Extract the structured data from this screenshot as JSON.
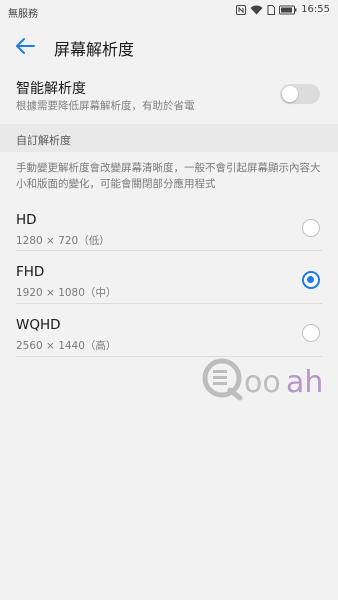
{
  "status_bar": {
    "carrier": "無服務",
    "time": "16:55",
    "icons": [
      "nfc-icon",
      "wifi-icon",
      "sim-icon",
      "battery-icon"
    ]
  },
  "header": {
    "title": "屏幕解析度",
    "back_icon": "arrow-left-icon"
  },
  "smart_resolution": {
    "title": "智能解析度",
    "description": "根據需要降低屏幕解析度，有助於省電",
    "enabled": false
  },
  "custom_section": {
    "title": "自訂解析度",
    "description": "手動變更解析度會改變屏幕清晰度，一般不會引起屏幕顯示內容大小和版面的變化，可能會關閉部分應用程式",
    "options": [
      {
        "name": "HD",
        "detail": "1280 × 720（低）",
        "selected": false
      },
      {
        "name": "FHD",
        "detail": "1920 × 1080（中）",
        "selected": true
      },
      {
        "name": "WQHD",
        "detail": "2560 × 1440（高）",
        "selected": false
      }
    ]
  },
  "watermark": {
    "text": "Qooah",
    "prefix": "Qoo",
    "suffix": "ah"
  },
  "colors": {
    "accent": "#1e7ce8",
    "background": "#f2f2f2",
    "section_header": "#e9e9e9",
    "watermark_grey": "#bdbdbd",
    "watermark_purple": "#b896c9"
  }
}
